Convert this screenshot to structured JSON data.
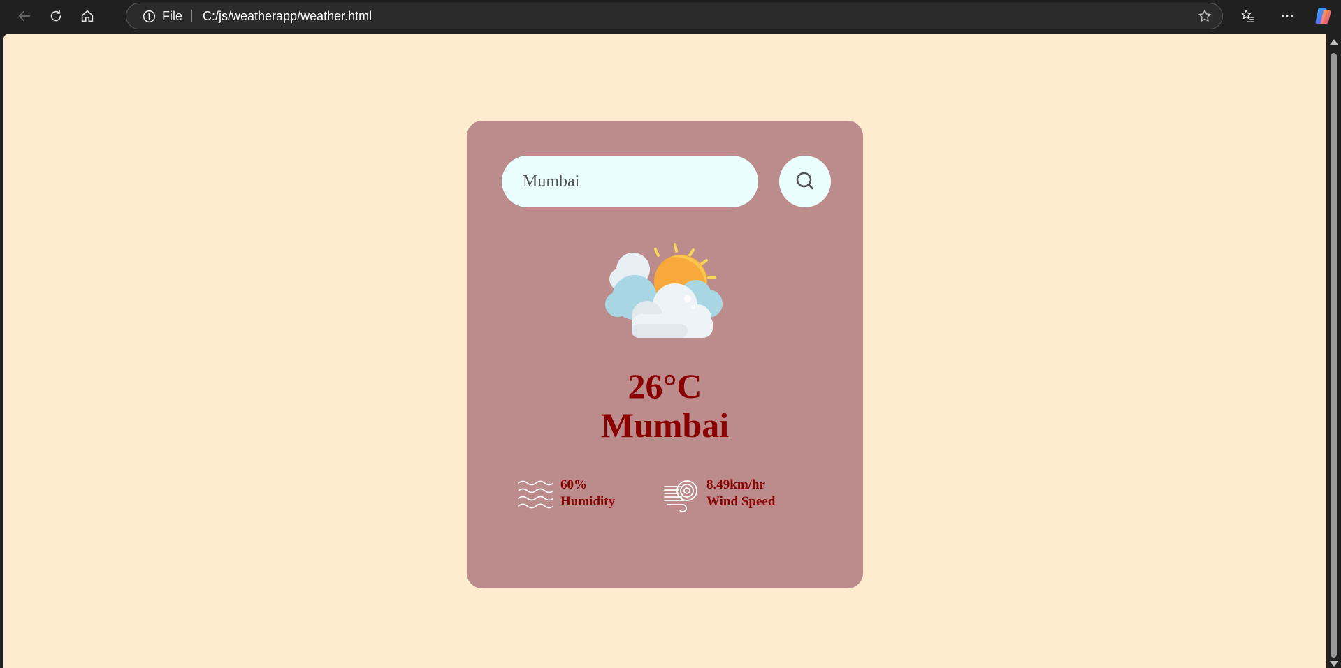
{
  "browser": {
    "site_label": "File",
    "url": "C:/js/weatherapp/weather.html",
    "icons": {
      "back": "back-arrow-icon",
      "reload": "reload-icon",
      "home": "home-icon",
      "info": "info-icon",
      "favorite": "star-icon",
      "favorites": "favorites-icon",
      "more": "more-icon",
      "copilot": "copilot-icon"
    }
  },
  "weather": {
    "search_value": "Mumbai",
    "search_icon": "search-icon",
    "condition_icon": "partly-cloudy-icon",
    "temperature": "26°C",
    "city": "Mumbai",
    "humidity": {
      "value": "60%",
      "label": "Humidity",
      "icon": "humidity-icon"
    },
    "wind": {
      "value": "8.49km/hr",
      "label": "Wind Speed",
      "icon": "wind-icon"
    }
  },
  "colors": {
    "page_background": "#FFEBCD",
    "card_background": "#BC8C8C",
    "input_background": "#EAFFFD",
    "text_accent": "#8B0000",
    "browser_chrome": "#202020"
  }
}
